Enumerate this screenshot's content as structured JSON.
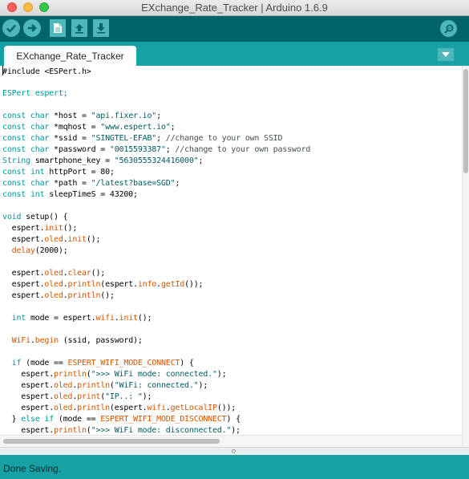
{
  "window": {
    "title": "EXchange_Rate_Tracker | Arduino 1.6.9"
  },
  "toolbar": {
    "buttons": [
      {
        "name": "verify",
        "icon": "check-icon"
      },
      {
        "name": "upload",
        "icon": "arrow-right-icon"
      },
      {
        "name": "new",
        "icon": "new-file-icon"
      },
      {
        "name": "open",
        "icon": "arrow-up-icon"
      },
      {
        "name": "save",
        "icon": "arrow-down-icon"
      },
      {
        "name": "serial-monitor",
        "icon": "magnifier-icon"
      }
    ]
  },
  "tabs": [
    {
      "label": "EXchange_Rate_Tracker",
      "active": true
    }
  ],
  "code": {
    "lines": [
      "#include <ESPert.h>",
      "",
      "ESPert espert;",
      "",
      "const char *host = \"api.fixer.io\";",
      "const char *mqhost = \"www.espert.io\";",
      "const char *ssid = \"SINGTEL-EFAB\"; //change to your own SSID",
      "const char *password = \"0015593387\"; //change to your own password",
      "String smartphone_key = \"5630555324416000\";",
      "const int httpPort = 80;",
      "const char *path = \"/latest?base=SGD\";",
      "const int sleepTimeS = 43200;",
      "",
      "void setup() {",
      "  espert.init();",
      "  espert.oled.init();",
      "  delay(2000);",
      "",
      "  espert.oled.clear();",
      "  espert.oled.println(espert.info.getId());",
      "  espert.oled.println();",
      "",
      "  int mode = espert.wifi.init();",
      "",
      "  WiFi.begin (ssid, password);",
      "",
      "  if (mode == ESPERT_WIFI_MODE_CONNECT) {",
      "    espert.println(\">>> WiFi mode: connected.\");",
      "    espert.oled.println(\"WiFi: connected.\");",
      "    espert.oled.print(\"IP..: \");",
      "    espert.oled.println(espert.wifi.getLocalIP());",
      "  } else if (mode == ESPERT_WIFI_MODE_DISCONNECT) {",
      "    espert.println(\">>> WiFi mode: disconnected.\");"
    ]
  },
  "status": {
    "message": "Done Saving."
  },
  "colors": {
    "toolbar": "#006468",
    "tabbar": "#17a1a5",
    "button": "#4db7bb",
    "keyword": "#00979c",
    "function": "#d35400",
    "string": "#005c5f",
    "comment": "#434f54"
  }
}
